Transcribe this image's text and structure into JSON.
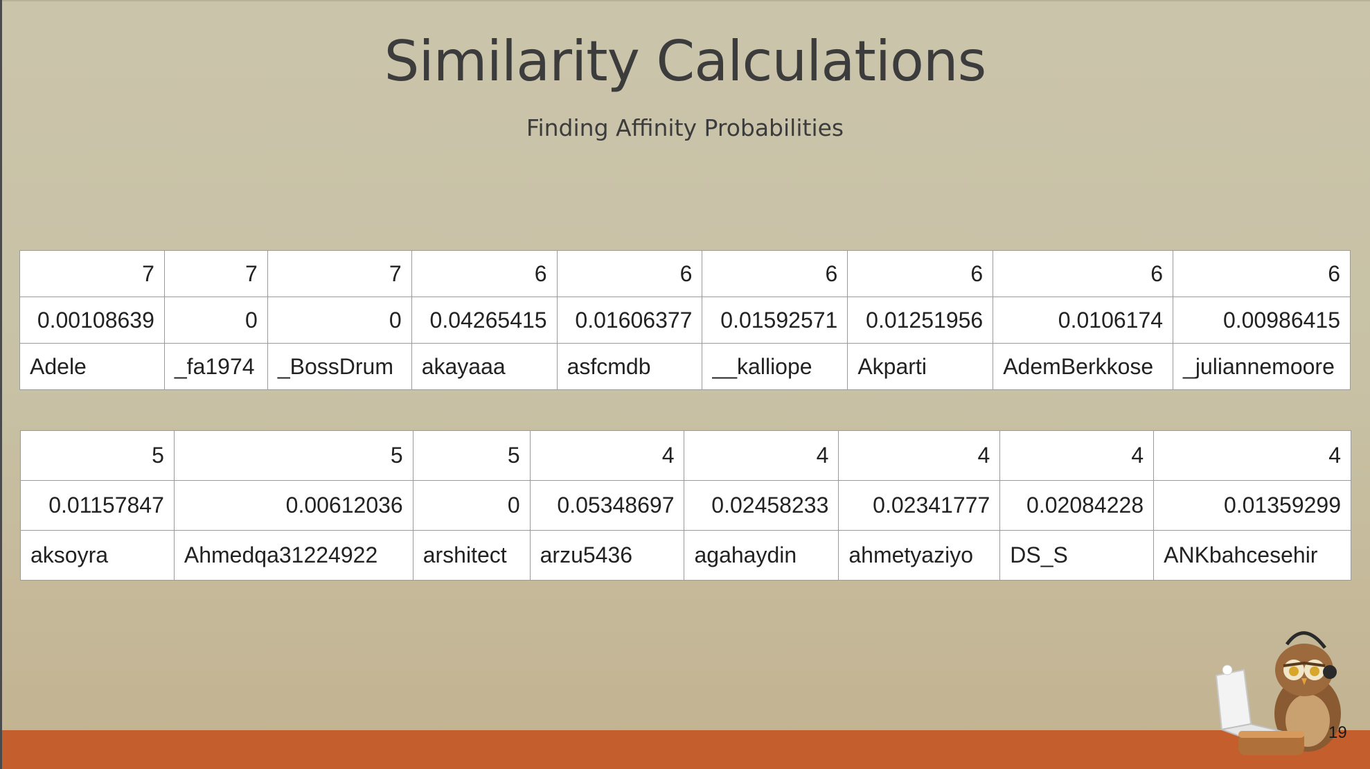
{
  "slide": {
    "title": "Similarity Calculations",
    "subtitle": "Finding Affinity Probabilities",
    "page_number": "19"
  },
  "colors": {
    "footer_bar": "#c45e2c",
    "title_text": "#3c3c3c",
    "table_background": "#ffffff"
  },
  "icons": {
    "mascot": "owl-with-laptop-icon"
  },
  "table1": {
    "counts": [
      "7",
      "7",
      "7",
      "6",
      "6",
      "6",
      "6",
      "6",
      "6"
    ],
    "scores": [
      "0.00108639",
      "0",
      "0",
      "0.04265415",
      "0.01606377",
      "0.01592571",
      "0.01251956",
      "0.0106174",
      "0.00986415"
    ],
    "names": [
      "Adele",
      "_fa1974",
      "_BossDrum",
      "akayaaa",
      "asfcmdb",
      "__kalliope",
      "Akparti",
      "AdemBerkkose",
      "_juliannemoore"
    ]
  },
  "table2": {
    "counts": [
      "5",
      "5",
      "5",
      "4",
      "4",
      "4",
      "4",
      "4"
    ],
    "scores": [
      "0.01157847",
      "0.00612036",
      "0",
      "0.05348697",
      "0.02458233",
      "0.02341777",
      "0.02084228",
      "0.01359299"
    ],
    "names": [
      "aksoyra",
      "Ahmedqa31224922",
      "arshitect",
      "arzu5436",
      "agahaydin",
      "ahmetyaziyo",
      "DS_S",
      "ANKbahcesehir"
    ]
  }
}
